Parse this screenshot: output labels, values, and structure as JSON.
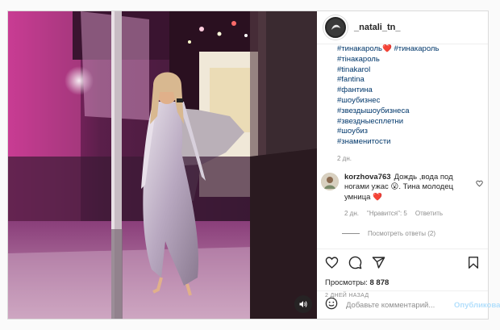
{
  "post": {
    "username": "_natali_tn_",
    "hashtags": [
      "#тинакароль❤️ #тинакароль",
      "#тінакароль",
      "#tinakarol",
      "#fantina",
      "#фантина",
      "#шоубизнес",
      "#звездышоубизнеса",
      "#звездныесплетни",
      "#шоубиз",
      "#знаменитости"
    ],
    "caption_time": "2 дн.",
    "comment": {
      "user": "korzhova763",
      "text": "Дождь ,вода под ногами ужас 😮. Тина молодец умница ❤️",
      "time": "2 дн.",
      "likes": "\"Нравится\": 5",
      "reply": "Ответить",
      "view_replies": "Посмотреть ответы (2)"
    },
    "views_label": "Просмотры:",
    "views_count": "8 878",
    "date": "2 ДНЕЙ НАЗАД",
    "add_comment_placeholder": "Добавьте комментарий...",
    "publish_label": "Опубликовать"
  },
  "icons": {
    "like": "heart-icon",
    "comment": "comment-icon",
    "share": "share-icon",
    "save": "bookmark-icon",
    "emoji": "emoji-icon",
    "sound": "speaker-icon"
  },
  "colors": {
    "link": "#00376b",
    "muted": "#8e8e8e",
    "publish": "#b2dffc",
    "heart": "#ed4956"
  }
}
